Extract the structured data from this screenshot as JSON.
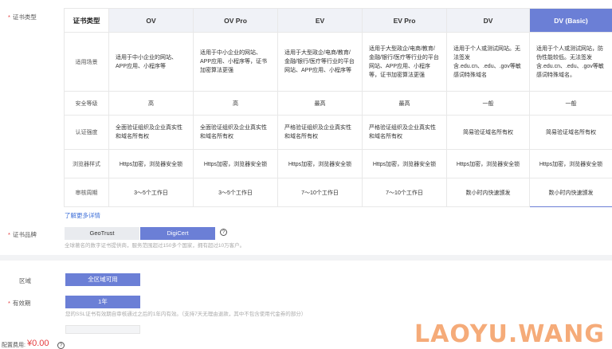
{
  "cert_type": {
    "label": "证书类型",
    "corner": "证书类型",
    "columns": [
      "OV",
      "OV Pro",
      "EV",
      "EV Pro",
      "DV",
      "DV (Basic)"
    ],
    "row_labels": [
      "适用场景",
      "安全等级",
      "认证强度",
      "浏览器样式",
      "审核周期"
    ],
    "scenarios": [
      "适用于中小企业的网站、APP应用、小程序等",
      "适用于中小企业的网站、APP应用、小程序等，证书加密算法更强",
      "适用于大型政企/电商/教育/金融/银行/医疗等行业的平台网站、APP应用、小程序等",
      "适用于大型政企/电商/教育/金融/银行/医疗等行业的平台网站、APP应用、小程序等，证书加密算法更强",
      "适用于个人或测试网站。无法签发含.edu.cn、.edu、.gov等敏感词特殊域名",
      "适用于个人或测试网站，防伪性能较低。无法签发含.edu.cn、.edu、.gov等敏感词特殊域名。"
    ],
    "security": [
      "高",
      "高",
      "最高",
      "最高",
      "一般",
      "一般"
    ],
    "auth": [
      "全面验证组织及企业真实性和域名所有权",
      "全面验证组织及企业真实性和域名所有权",
      "严格验证组织及企业真实性和域名所有权",
      "严格验证组织及企业真实性和域名所有权",
      "简易验证域名所有权",
      "简易验证域名所有权"
    ],
    "browser": [
      "Https加密，浏览器安全锁",
      "Https加密，浏览器安全锁",
      "Https加密，浏览器安全锁",
      "Https加密，浏览器安全锁",
      "Https加密，浏览器安全锁",
      "Https加密，浏览器安全锁"
    ],
    "review": [
      "3～5个工作日",
      "3～5个工作日",
      "7～10个工作日",
      "7～10个工作日",
      "数小时内快速颁发",
      "数小时内快速颁发"
    ],
    "selected": "DV (Basic)"
  },
  "more_link": "了解更多详情",
  "brand": {
    "label": "证书品牌",
    "options": [
      "GeoTrust",
      "DigiCert"
    ],
    "selected": "DigiCert",
    "description": "全球著名的数字证书提供商，服务范围超过150多个国家，拥有超过10万客户。"
  },
  "region": {
    "label": "区域",
    "value": "全区域可用"
  },
  "validity": {
    "label": "有效期",
    "value": "1年",
    "description": "您的SSL证书有效期自审核通过之后的1年内有效。（支持7天无理由退款，其中不包含使用代金券的部分）"
  },
  "fee": {
    "label": "配置费用:",
    "amount": "¥0.00"
  },
  "watermark": "LAOYU.WANG",
  "colors": {
    "accent": "#6b7fd6",
    "price": "#e4393c",
    "link": "#3e6fd8"
  }
}
